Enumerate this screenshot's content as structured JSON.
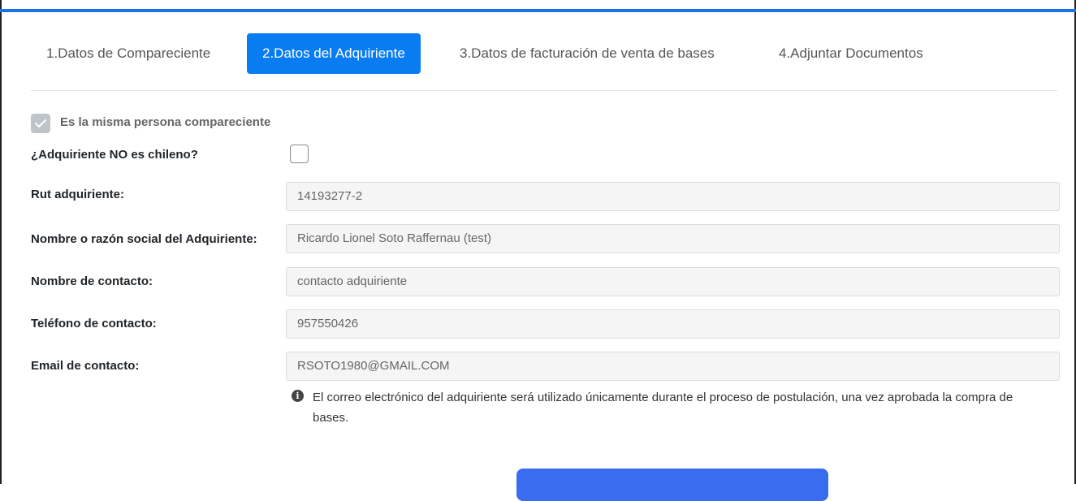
{
  "tabs": [
    {
      "label": "1.Datos de Compareciente",
      "active": false
    },
    {
      "label": "2.Datos del Adquiriente",
      "active": true
    },
    {
      "label": "3.Datos de facturación de venta de bases",
      "active": false
    },
    {
      "label": "4.Adjuntar Documentos",
      "active": false
    }
  ],
  "form": {
    "same_person": {
      "label": "Es la misma persona compareciente",
      "checked": true
    },
    "not_chilean": {
      "label": "¿Adquiriente NO es chileno?",
      "checked": false
    },
    "rut": {
      "label": "Rut adquiriente:",
      "value": "14193277-2"
    },
    "name": {
      "label": "Nombre o razón social del Adquiriente:",
      "value": "Ricardo Lionel Soto Raffernau (test)"
    },
    "contact_name": {
      "label": "Nombre de contacto:",
      "value": "contacto adquiriente"
    },
    "phone": {
      "label": "Teléfono de contacto:",
      "value": "957550426"
    },
    "email": {
      "label": "Email de contacto:",
      "value": "RSOTO1980@GMAIL.COM"
    },
    "email_note": "El correo electrónico del adquiriente será utilizado únicamente durante el proceso de postulación, una vez aprobada la compra de bases."
  },
  "colors": {
    "accent": "#0a7cf2",
    "top_bar": "#1a73e8",
    "submit": "#3a6cf0"
  },
  "icons": {
    "checked": "check-icon",
    "info": "info-circle-icon"
  }
}
